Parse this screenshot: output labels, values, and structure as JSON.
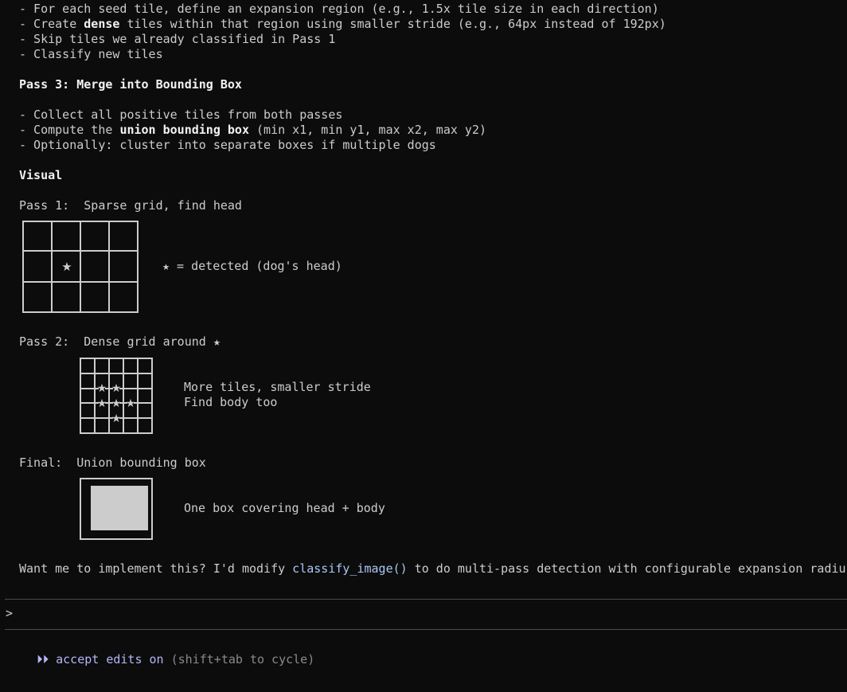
{
  "lines": {
    "l1": "- For each seed tile, define an expansion region (e.g., 1.5x tile size in each direction)",
    "l2_a": "- Create ",
    "l2_b": "dense",
    "l2_c": " tiles within that region using smaller stride (e.g., 64px instead of 192px)",
    "l3": "- Skip tiles we already classified in Pass 1",
    "l4": "- Classify new tiles",
    "pass3_heading": "Pass 3: Merge into Bounding Box",
    "l5": "- Collect all positive tiles from both passes",
    "l6_a": "- Compute the ",
    "l6_b": "union bounding box",
    "l6_c": " (min x1, min y1, max x2, max y2)",
    "l7": "- Optionally: cluster into separate boxes if multiple dogs",
    "visual_heading": "Visual",
    "pass1_label": "Pass 1:  Sparse grid, find head",
    "pass1_note": "★ = detected (dog's head)",
    "pass2_label": "Pass 2:  Dense grid around ★",
    "pass2_note1": "More tiles, smaller stride",
    "pass2_note2": "Find body too",
    "final_label": "Final:  Union bounding box",
    "final_note": "One box covering head + body",
    "question_a": "Want me to implement this? I'd modify ",
    "question_fn": "classify_image()",
    "question_b": " to do multi-pass detection with configurable expansion radius"
  },
  "prompt": {
    "symbol": ">",
    "value": ""
  },
  "mode": {
    "icon": "fast-forward-icon",
    "icon_glyph": "⏵⏵",
    "label": "accept edits on",
    "hint": "(shift+tab to cycle)"
  },
  "colors": {
    "background": "#0c0c0c",
    "text": "#cccccc",
    "bold": "#f2f2f2",
    "function": "#a9c8f5",
    "accent": "#b3b6f7",
    "hint": "#8a8a8a"
  }
}
